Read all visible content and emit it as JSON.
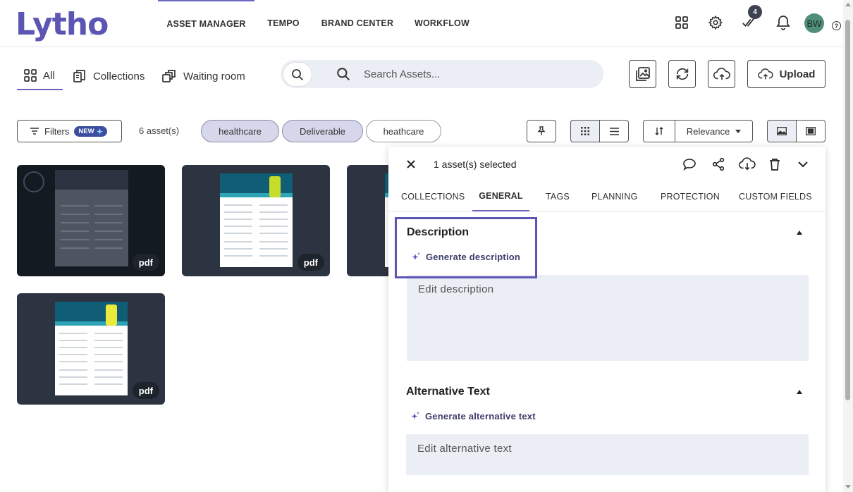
{
  "app": {
    "logo": "Lytho"
  },
  "nav": {
    "items": [
      "ASSET MANAGER",
      "TEMPO",
      "BRAND CENTER",
      "WORKFLOW"
    ],
    "active": "ASSET MANAGER"
  },
  "header": {
    "task_count": "4",
    "avatar_initials": "BW",
    "help": "?"
  },
  "subnav": {
    "all": "All",
    "collections": "Collections",
    "waiting_room": "Waiting room"
  },
  "search": {
    "placeholder": "Search Assets..."
  },
  "actions": {
    "upload": "Upload"
  },
  "filters": {
    "label": "Filters",
    "new_badge": "NEW",
    "asset_count": "6 asset(s)",
    "chips": [
      "healthcare",
      "Deliverable",
      "heathcare"
    ]
  },
  "sort": {
    "label": "Relevance"
  },
  "assets": [
    {
      "type": "pdf"
    },
    {
      "type": "pdf"
    },
    {
      "type": "pdf"
    },
    {
      "type": "pdf"
    }
  ],
  "panel": {
    "title": "1 asset(s) selected",
    "tabs": [
      "COLLECTIONS",
      "GENERAL",
      "TAGS",
      "PLANNING",
      "PROTECTION",
      "CUSTOM FIELDS"
    ],
    "active_tab": "GENERAL",
    "description": {
      "title": "Description",
      "generate": "Generate description",
      "placeholder": "Edit description"
    },
    "alt_text": {
      "title": "Alternative Text",
      "generate": "Generate alternative text",
      "placeholder": "Edit alternative text"
    }
  },
  "colors": {
    "brand": "#5b55b4",
    "accent": "#6b65c0",
    "chip_bg": "#d7d7ec",
    "card_bg": "#2b3440"
  }
}
